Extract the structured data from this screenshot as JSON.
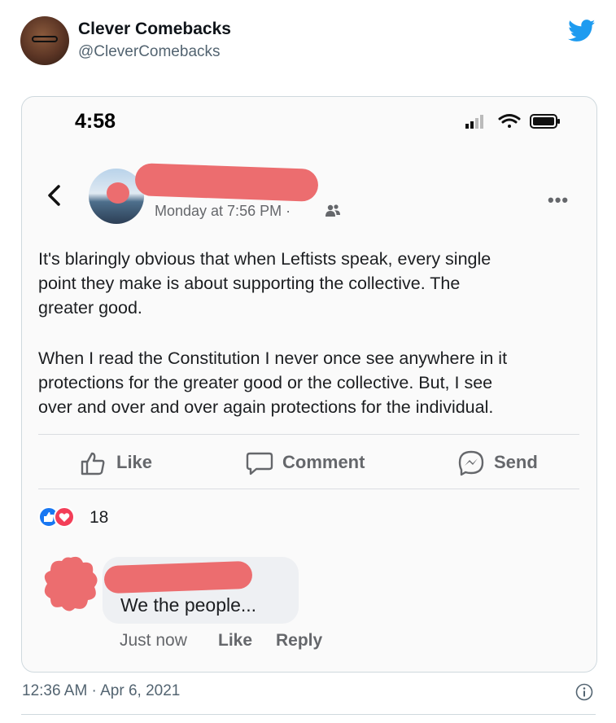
{
  "tweet": {
    "display_name": "Clever Comebacks",
    "handle": "@CleverComebacks",
    "timestamp": "12:36 AM · Apr 6, 2021",
    "brand_color": "#1d9bf0"
  },
  "phone": {
    "time": "4:58",
    "post": {
      "meta": "Monday at 7:56 PM ·",
      "paragraph1": [
        "It's blaringly obvious that when Leftists speak, every single",
        "point they make is about supporting the collective. The",
        "greater good."
      ],
      "paragraph2": [
        "When I read the Constitution I never once see anywhere in it",
        "protections for the greater good or the collective. But, I see",
        "over and over and over again protections for the individual."
      ],
      "actions": {
        "like": "Like",
        "comment": "Comment",
        "send": "Send"
      },
      "reaction_count": "18"
    },
    "comment": {
      "text": "We the people...",
      "time": "Just now",
      "like": "Like",
      "reply": "Reply"
    },
    "redaction_color": "#ec6d6f"
  }
}
